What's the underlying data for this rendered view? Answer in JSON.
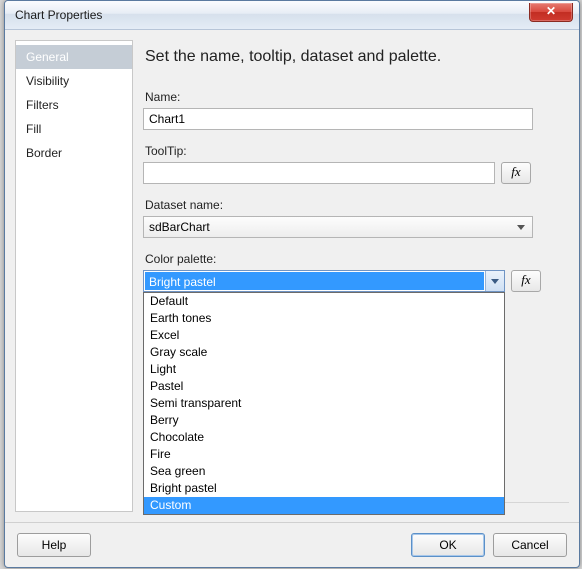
{
  "window": {
    "title": "Chart Properties",
    "close_symbol": "✕"
  },
  "sidebar": {
    "items": [
      {
        "label": "General",
        "selected": true
      },
      {
        "label": "Visibility",
        "selected": false
      },
      {
        "label": "Filters",
        "selected": false
      },
      {
        "label": "Fill",
        "selected": false
      },
      {
        "label": "Border",
        "selected": false
      }
    ]
  },
  "main": {
    "heading": "Set the name, tooltip, dataset and palette.",
    "name_label": "Name:",
    "name_value": "Chart1",
    "tooltip_label": "ToolTip:",
    "tooltip_value": "",
    "fx_label": "fx",
    "dataset_label": "Dataset name:",
    "dataset_value": "sdBarChart",
    "palette_label": "Color palette:",
    "palette_value": "Bright pastel",
    "palette_options": [
      "Default",
      "Earth tones",
      "Excel",
      "Gray scale",
      "Light",
      "Pastel",
      "Semi transparent",
      "Berry",
      "Chocolate",
      "Fire",
      "Sea green",
      "Bright pastel",
      "Custom"
    ],
    "palette_highlight": "Custom"
  },
  "footer": {
    "help": "Help",
    "ok": "OK",
    "cancel": "Cancel"
  }
}
